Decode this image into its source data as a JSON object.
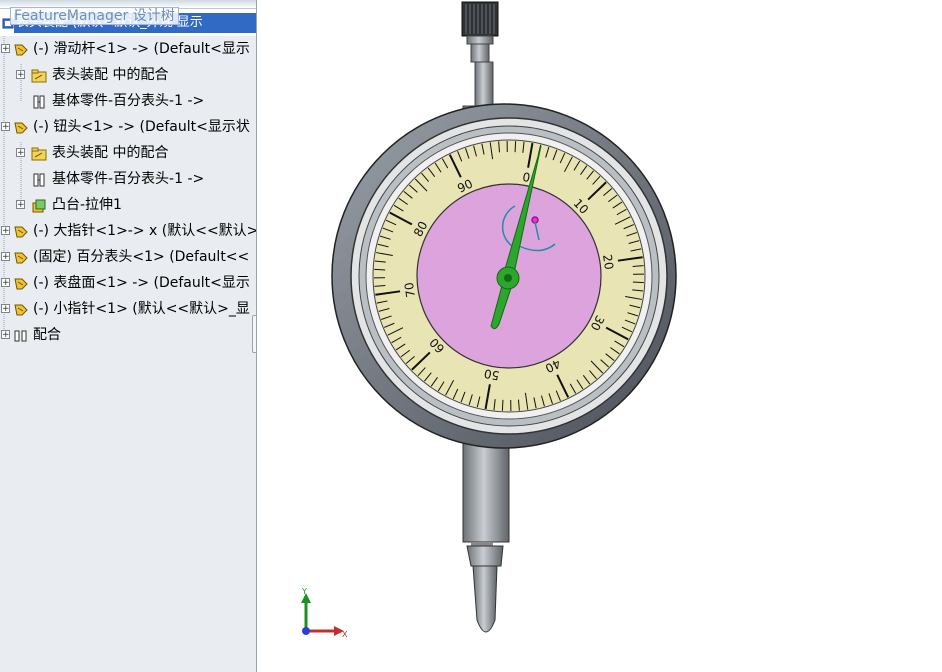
{
  "tooltip": "FeatureManager 设计树",
  "tree": {
    "root_label": "表头装配 (默认<默认_外观 显示",
    "items": [
      {
        "label": "(-) 滑动杆<1> -> (Default<显示",
        "icon": "component-part-icon"
      },
      {
        "label": "表头装配 中的配合",
        "icon": "mates-folder-icon"
      },
      {
        "label": "基体零件-百分表头-1 ->",
        "icon": "base-part-icon"
      },
      {
        "label": "(-) 钮头<1> -> (Default<显示状",
        "icon": "component-part-icon"
      },
      {
        "label": "表头装配 中的配合",
        "icon": "mates-folder-icon"
      },
      {
        "label": "基体零件-百分表头-1 ->",
        "icon": "base-part-icon"
      },
      {
        "label": "凸台-拉伸1",
        "icon": "extrude-feature-icon"
      },
      {
        "label": "(-) 大指针<1>-> x (默认<<默认>",
        "icon": "component-part-icon"
      },
      {
        "label": "(固定) 百分表头<1> (Default<<",
        "icon": "component-part-icon"
      },
      {
        "label": "(-) 表盘面<1> -> (Default<显示",
        "icon": "component-part-icon"
      },
      {
        "label": "(-) 小指针<1> (默认<<默认>_显",
        "icon": "component-part-icon"
      },
      {
        "label": "配合",
        "icon": "mates-icon"
      }
    ]
  },
  "dial": {
    "labels": [
      "0",
      "10",
      "20",
      "30",
      "40",
      "50",
      "60",
      "70",
      "80",
      "90"
    ],
    "pointer_value": 93
  },
  "triad": {
    "x_label": "X",
    "y_label": "Y"
  },
  "colors": {
    "selection": "#316ac5",
    "dial_face": "#e8e4b4",
    "center_face": "#dda3dd",
    "pointer": "#2ea52e",
    "bezel": "#6e7580"
  }
}
